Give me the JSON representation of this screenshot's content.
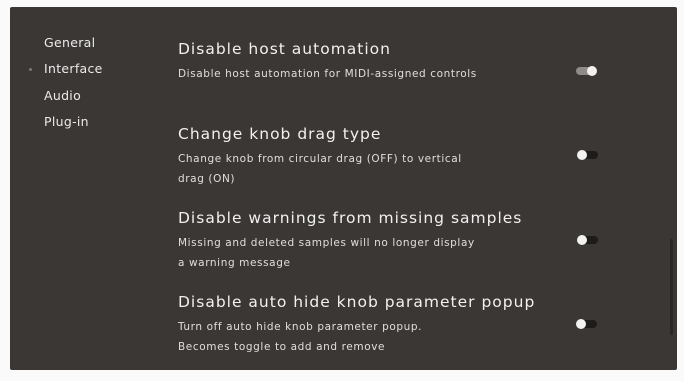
{
  "sidebar": {
    "items": [
      {
        "label": "General",
        "active": false
      },
      {
        "label": "Interface",
        "active": true
      },
      {
        "label": "Audio",
        "active": false
      },
      {
        "label": "Plug-in",
        "active": false
      }
    ]
  },
  "settings": [
    {
      "title": "Disable host automation",
      "description": "Disable host automation for MIDI-assigned controls",
      "enabled": true
    },
    {
      "title": "Change knob drag type",
      "description": "Change knob from circular drag (OFF) to vertical drag (ON)",
      "enabled": false
    },
    {
      "title": "Disable warnings from missing samples",
      "description": "Missing and deleted samples will no longer display a warning message",
      "enabled": false
    },
    {
      "title": "Disable auto hide knob parameter popup",
      "description": "Turn off auto hide knob parameter popup. Becomes toggle to add and remove",
      "enabled": false
    }
  ],
  "colors": {
    "panel_background": "#3a3735",
    "text": "#f2f1f0",
    "toggle_on_track": "#8f8b87",
    "toggle_off_track": "#1e1c1b"
  }
}
